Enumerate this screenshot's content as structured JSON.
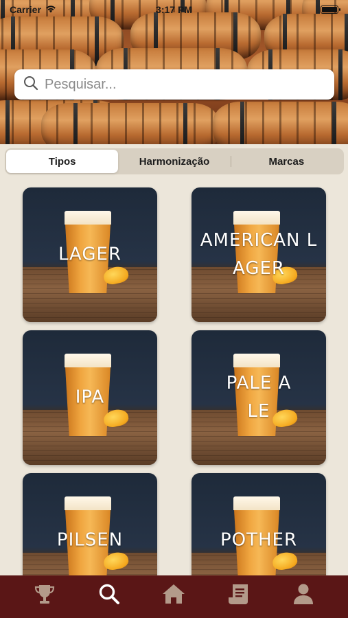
{
  "status_bar": {
    "carrier": "Carrier",
    "time": "3:17 PM"
  },
  "search": {
    "placeholder": "Pesquisar...",
    "value": ""
  },
  "segmented": {
    "items": [
      {
        "label": "Tipos",
        "active": true
      },
      {
        "label": "Harmonização",
        "active": false
      },
      {
        "label": "Marcas",
        "active": false
      }
    ]
  },
  "cards": [
    {
      "label": "LAGER"
    },
    {
      "label": "AMERICAN LAGER"
    },
    {
      "label": "IPA"
    },
    {
      "label": "PALE ALE"
    },
    {
      "label": "PILSEN"
    },
    {
      "label": "POTHER"
    }
  ],
  "tabbar": {
    "items": [
      {
        "icon": "trophy-icon",
        "active": false
      },
      {
        "icon": "search-icon",
        "active": true
      },
      {
        "icon": "home-icon",
        "active": false
      },
      {
        "icon": "receipt-icon",
        "active": false
      },
      {
        "icon": "user-icon",
        "active": false
      }
    ]
  },
  "colors": {
    "background": "#ece6da",
    "tabbar": "#5a1616",
    "tab_icon_inactive": "#b39a8a",
    "tab_icon_active": "#ffffff"
  }
}
